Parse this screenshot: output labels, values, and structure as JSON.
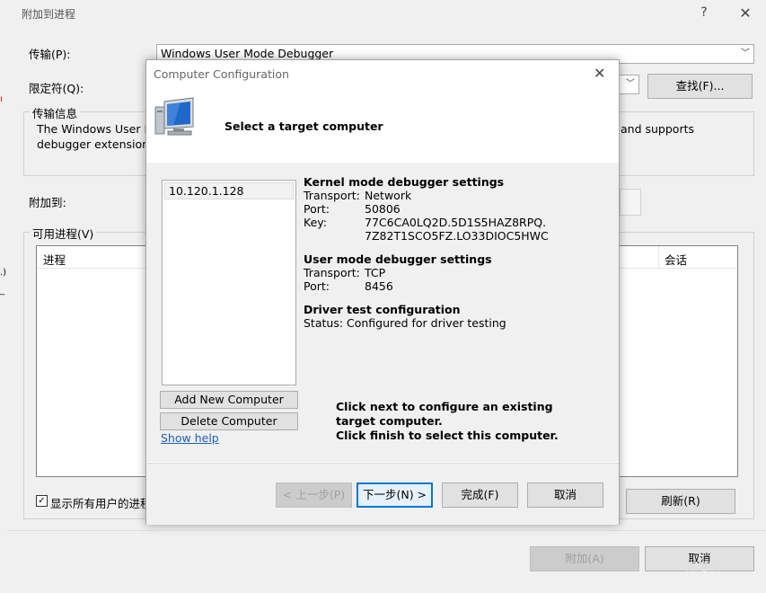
{
  "outer": {
    "title": "附加到进程",
    "help_glyph": "?",
    "close_glyph": "✕",
    "transport_label": "传输(P):",
    "transport_value": "Windows User Mode Debugger",
    "qualifier_label": "限定符(Q):",
    "find_button": "查找(F)...",
    "transport_info_title": "传输信息",
    "transport_info_line1_left": "The Windows User M",
    "transport_info_line1_right": "and supports",
    "transport_info_line2": "debugger extensions",
    "attach_to_label": "附加到:",
    "available_processes_title": "可用进程(V)",
    "col_process": "进程",
    "col_session": "会话",
    "show_all_users_label": "显示所有用户的进程",
    "refresh_button": "刷新(R)",
    "attach_button": "附加(A)",
    "cancel_button": "取消",
    "watermark": "亿速云"
  },
  "inner": {
    "title": "Computer Configuration",
    "close_glyph": "✕",
    "header_text": "Select a target computer",
    "computers": [
      "10.120.1.128"
    ],
    "add_button": "Add New Computer",
    "delete_button": "Delete Computer",
    "show_help": "Show help",
    "kernel": {
      "heading": "Kernel mode debugger settings",
      "transport_label": "Transport:",
      "transport_value": "Network",
      "port_label": "Port:",
      "port_value": "50806",
      "key_label": "Key:",
      "key_value_1": "77C6CA0LQ2D.5D1S5HAZ8RPQ.",
      "key_value_2": "7Z82T1SCO5FZ.LO33DIOC5HWC"
    },
    "user": {
      "heading": "User mode debugger settings",
      "transport_label": "Transport:",
      "transport_value": "TCP",
      "port_label": "Port:",
      "port_value": "8456"
    },
    "driver": {
      "heading": "Driver test configuration",
      "status_label": "Status:",
      "status_value": "Configured for driver testing"
    },
    "hint_line1": "Click next to configure an existing target computer.",
    "hint_line2": "Click finish to select this computer.",
    "prev_button": "< 上一步(P)",
    "next_button": "下一步(N) >",
    "finish_button": "完成(F)",
    "cancel_button": "取消"
  }
}
